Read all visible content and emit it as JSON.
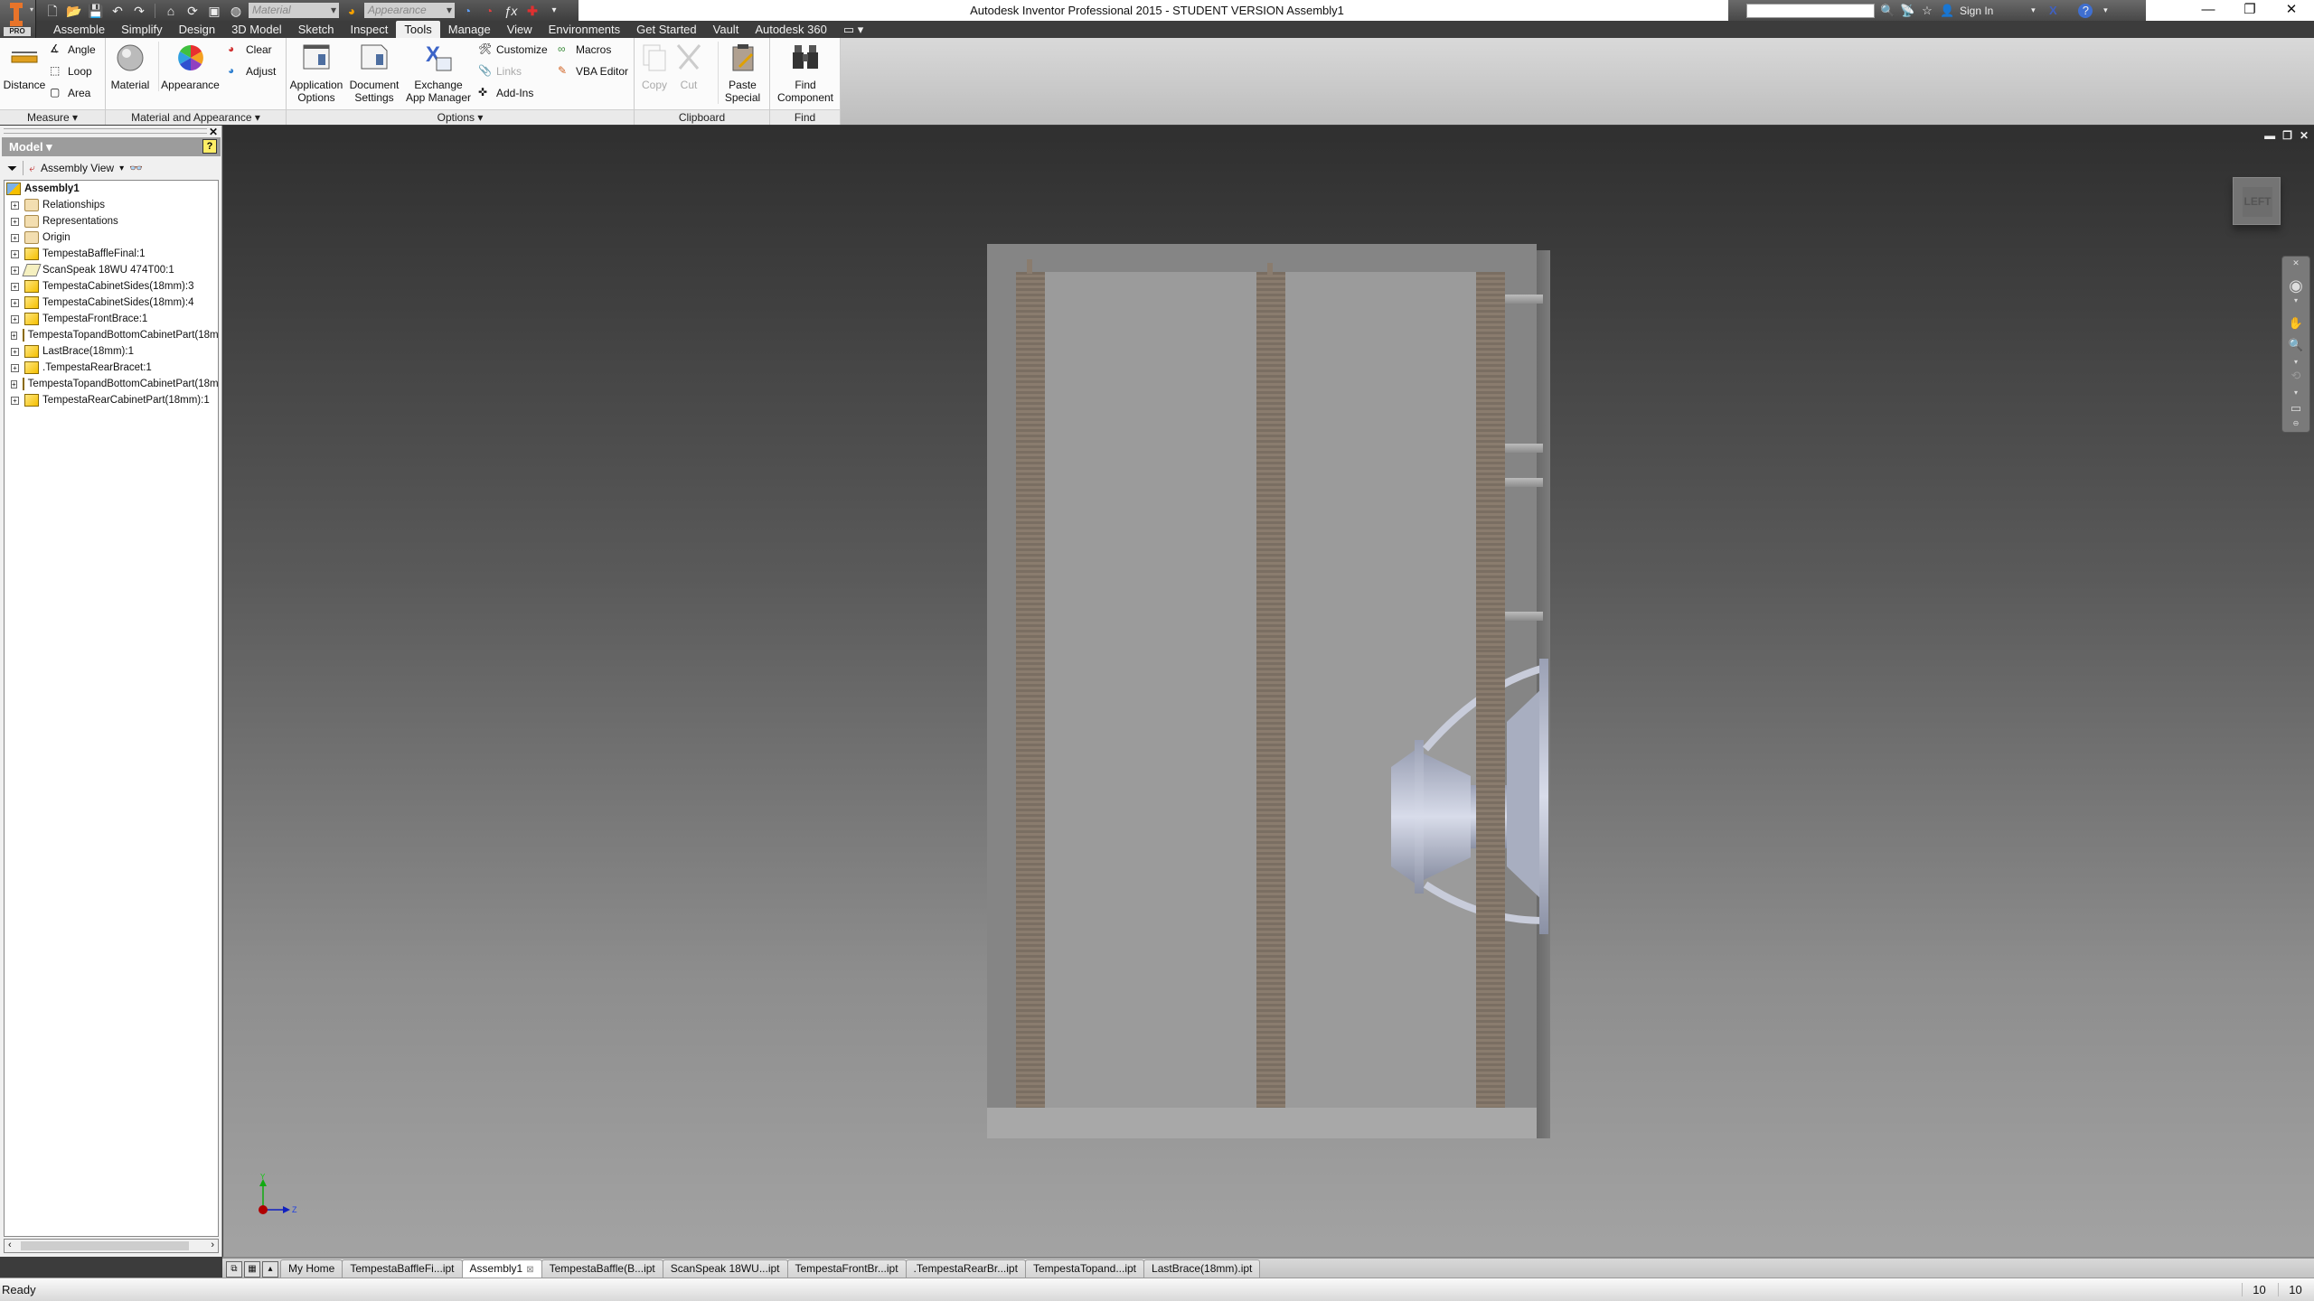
{
  "window": {
    "title": "Autodesk Inventor Professional 2015 - STUDENT VERSION    Assembly1",
    "controls": {
      "minimize": "—",
      "restore": "❐",
      "close": "✕"
    }
  },
  "app_button": {
    "badge": "PRO"
  },
  "quick_access": {
    "icons": [
      "new-icon",
      "open-icon",
      "save-icon",
      "undo-icon",
      "redo-icon",
      "home-icon",
      "update-icon",
      "select-icon",
      "material-icon"
    ],
    "material_combo": "Material",
    "appearance_combo": "Appearance",
    "fx": "ƒx"
  },
  "infocenter": {
    "search_value": "",
    "sign_in": "Sign In",
    "help": "?"
  },
  "menu_tabs": [
    {
      "label": "Assemble",
      "active": false
    },
    {
      "label": "Simplify",
      "active": false
    },
    {
      "label": "Design",
      "active": false
    },
    {
      "label": "3D Model",
      "active": false
    },
    {
      "label": "Sketch",
      "active": false
    },
    {
      "label": "Inspect",
      "active": false
    },
    {
      "label": "Tools",
      "active": true
    },
    {
      "label": "Manage",
      "active": false
    },
    {
      "label": "View",
      "active": false
    },
    {
      "label": "Environments",
      "active": false
    },
    {
      "label": "Get Started",
      "active": false
    },
    {
      "label": "Vault",
      "active": false
    },
    {
      "label": "Autodesk 360",
      "active": false
    }
  ],
  "ribbon": {
    "measure": {
      "label": "Measure ▾",
      "distance": "Distance",
      "angle": "Angle",
      "loop": "Loop",
      "area": "Area"
    },
    "material_appearance": {
      "label": "Material and Appearance ▾",
      "material": "Material",
      "appearance": "Appearance",
      "clear": "Clear",
      "adjust": "Adjust"
    },
    "options": {
      "label": "Options ▾",
      "app_options_1": "Application",
      "app_options_2": "Options",
      "doc_settings_1": "Document",
      "doc_settings_2": "Settings",
      "exchange_1": "Exchange",
      "exchange_2": "App Manager",
      "customize": "Customize",
      "links": "Links",
      "add_ins": "Add-Ins",
      "macros": "Macros",
      "vba_editor": "VBA Editor"
    },
    "clipboard": {
      "label": "Clipboard",
      "copy": "Copy",
      "cut": "Cut",
      "paste_special_1": "Paste",
      "paste_special_2": "Special"
    },
    "find": {
      "label": "Find",
      "find_component_1": "Find",
      "find_component_2": "Component"
    }
  },
  "browser": {
    "header": "Model ▾",
    "view_selector": "Assembly View",
    "tree": [
      {
        "label": "Assembly1",
        "type": "root"
      },
      {
        "label": "Relationships",
        "type": "folder"
      },
      {
        "label": "Representations",
        "type": "folder"
      },
      {
        "label": "Origin",
        "type": "folder"
      },
      {
        "label": "TempestaBaffleFinal:1",
        "type": "part"
      },
      {
        "label": "ScanSpeak 18WU 474T00:1",
        "type": "subassembly"
      },
      {
        "label": "TempestaCabinetSides(18mm):3",
        "type": "part"
      },
      {
        "label": "TempestaCabinetSides(18mm):4",
        "type": "part"
      },
      {
        "label": "TempestaFrontBrace:1",
        "type": "part"
      },
      {
        "label": "TempestaTopandBottomCabinetPart(18m",
        "type": "part"
      },
      {
        "label": "LastBrace(18mm):1",
        "type": "part"
      },
      {
        "label": ".TempestaRearBracet:1",
        "type": "part"
      },
      {
        "label": "TempestaTopandBottomCabinetPart(18m",
        "type": "part"
      },
      {
        "label": "TempestaRearCabinetPart(18mm):1",
        "type": "part"
      }
    ]
  },
  "viewport": {
    "viewcube_face": "LEFT",
    "triad": {
      "y": "Y",
      "z": "Z"
    },
    "colors": {
      "brace": "#7d7064",
      "panel": "#9b9b9b",
      "x_axis": "#b00000",
      "y_axis": "#11aa11",
      "z_axis": "#1020c0"
    }
  },
  "doc_tabs": [
    {
      "label": "My Home",
      "active": false
    },
    {
      "label": "TempestaBaffleFi...ipt",
      "active": false
    },
    {
      "label": "Assembly1",
      "active": true,
      "closable": true
    },
    {
      "label": "TempestaBaffle(B...ipt",
      "active": false
    },
    {
      "label": "ScanSpeak 18WU...ipt",
      "active": false
    },
    {
      "label": "TempestaFrontBr...ipt",
      "active": false
    },
    {
      "label": ".TempestaRearBr...ipt",
      "active": false
    },
    {
      "label": "TempestaTopand...ipt",
      "active": false
    },
    {
      "label": "LastBrace(18mm).ipt",
      "active": false
    }
  ],
  "status": {
    "text": "Ready",
    "count1": "10",
    "count2": "10"
  }
}
